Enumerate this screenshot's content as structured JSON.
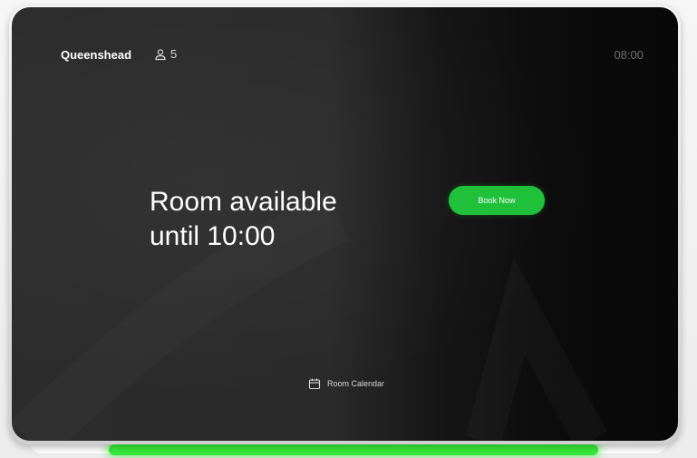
{
  "room": {
    "name": "Queenshead",
    "capacity": "5",
    "capacity_icon": "person-icon"
  },
  "clock": {
    "time": "08:00"
  },
  "status": {
    "line1": "Room available",
    "line2": "until 10:00"
  },
  "actions": {
    "book_now_label": "Book Now"
  },
  "footer": {
    "calendar_label": "Room Calendar",
    "calendar_icon": "calendar-icon"
  },
  "colors": {
    "accent_green": "#1fc13a",
    "led_green": "#36e83a",
    "screen_bg": "#2a2a2a"
  }
}
